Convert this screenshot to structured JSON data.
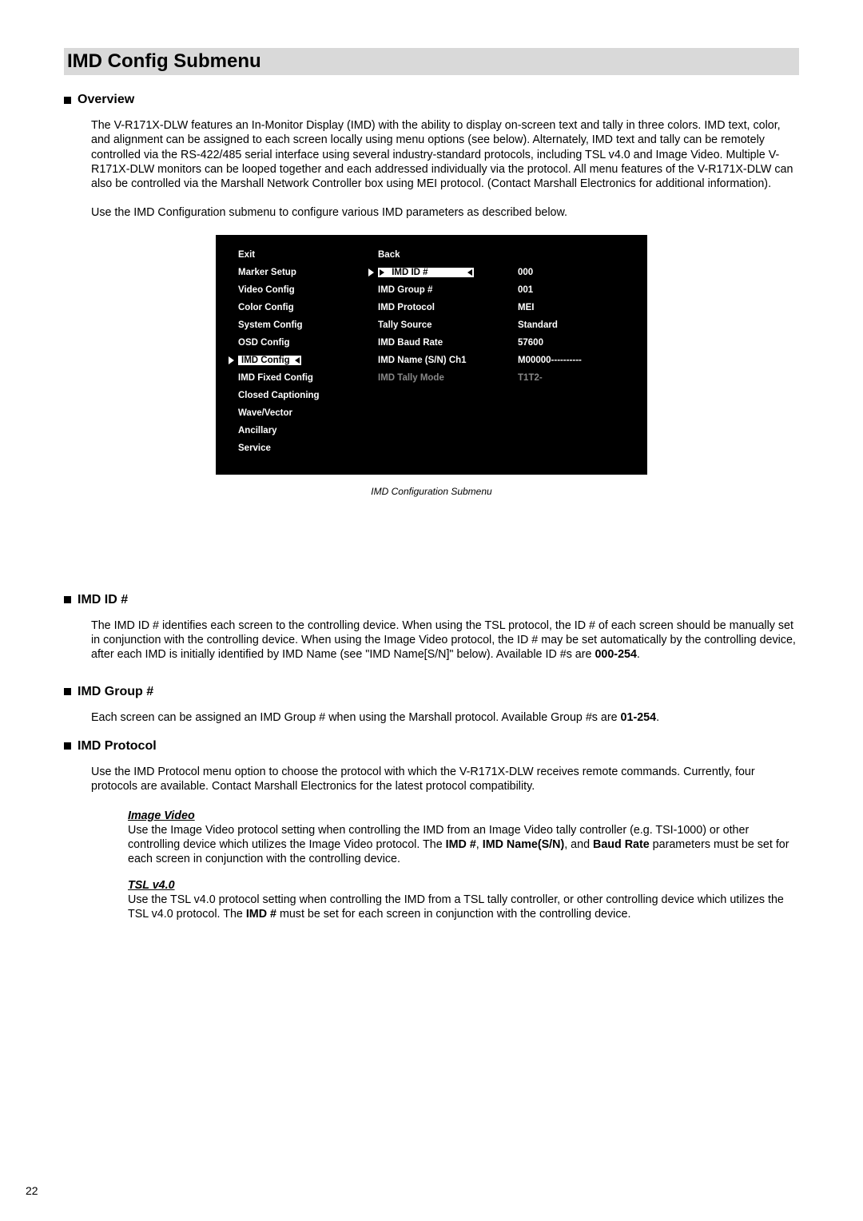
{
  "title": "IMD Config Submenu",
  "overview": {
    "header": "Overview",
    "p1": "The V-R171X-DLW features an In-Monitor Display (IMD) with the ability to display on-screen text and tally in three colors. IMD text, color, and alignment can be assigned to each screen locally using menu options (see below). Alternately, IMD text and tally can be remotely controlled via the RS-422/485 serial interface using several industry-standard protocols, including TSL v4.0 and Image Video. Multiple V-R171X-DLW monitors can be looped together and each addressed individually via the protocol. All menu features of the V-R171X-DLW can also be controlled via the Marshall Network Controller box using MEI protocol. (Contact Marshall Electronics for additional information).",
    "p2": "Use the IMD Configuration submenu to configure various IMD parameters as described below."
  },
  "screenshot": {
    "left": [
      "Exit",
      "Marker Setup",
      "Video Config",
      "Color Config",
      "System Config",
      "OSD Config",
      "IMD Config",
      "IMD Fixed Config",
      "Closed Captioning",
      "Wave/Vector",
      "Ancillary",
      "Service"
    ],
    "mid": [
      "Back",
      "IMD ID #",
      "IMD Group #",
      "IMD Protocol",
      "Tally Source",
      "IMD Baud Rate",
      "IMD Name (S/N) Ch1",
      "IMD Tally Mode"
    ],
    "right": [
      "",
      "000",
      "001",
      "MEI",
      "Standard",
      "57600",
      "M00000----------",
      "T1T2-"
    ],
    "selected_left_index": 6,
    "selected_mid_index": 1,
    "grey_mid_index": 7,
    "caption": "IMD Configuration Submenu"
  },
  "imdid": {
    "header": "IMD ID #",
    "p_before_bold": "The IMD ID # identifies each screen to the controlling device. When using the TSL protocol, the ID # of each screen should be manually set in conjunction with the controlling device. When using the Image Video protocol, the ID # may be set automatically by the controlling device, after each IMD is initially identified by IMD Name (see \"IMD Name[S/N]\" below). Available ID #s are ",
    "bold": "000-254",
    "p_after_bold": "."
  },
  "imdgroup": {
    "header": "IMD Group #",
    "p_before_bold": "Each screen can be assigned an IMD Group # when using the Marshall protocol. Available Group #s are ",
    "bold": "01-254",
    "p_after_bold": "."
  },
  "imdprotocol": {
    "header": "IMD Protocol",
    "p1": "Use the IMD Protocol menu option to choose the protocol with which the V-R171X-DLW receives remote commands. Currently, four protocols are available. Contact Marshall Electronics for the latest protocol compatibility.",
    "imagevideo": {
      "title": "Image Video",
      "t1": "Use the Image Video protocol setting when controlling the IMD from an Image Video tally controller (e.g. TSI-1000) or other controlling device which utilizes the Image Video protocol. The ",
      "b1": "IMD #",
      "t2": ", ",
      "b2": "IMD Name(S/N)",
      "t3": ", and ",
      "b3": "Baud Rate",
      "t4": " parameters must be set for each screen in conjunction with the controlling device."
    },
    "tsl": {
      "title": "TSL v4.0",
      "t1": "Use the TSL v4.0 protocol setting when controlling the IMD from a TSL tally controller, or other controlling device which utilizes the TSL v4.0 protocol. The ",
      "b1": "IMD #",
      "t2": " must be set for each screen in conjunction with the controlling device."
    }
  },
  "page_number": "22"
}
